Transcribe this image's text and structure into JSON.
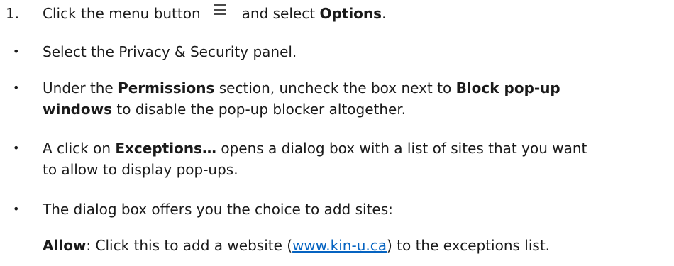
{
  "step1": {
    "number": "1.",
    "text_before": "Click the menu button",
    "menu_icon": "hamburger-menu-icon",
    "text_middle": "and select",
    "bold_term": "Options",
    "text_end": "."
  },
  "bullets": {
    "marker": "•",
    "privacy": {
      "text": "Select the Privacy & Security panel."
    },
    "permissions": {
      "part1": "Under the ",
      "bold1": "Permissions",
      "part2": " section, uncheck the box next to ",
      "bold2": "Block pop-up",
      "bold2_cont": "windows",
      "part3": " to disable the pop-up blocker altogether."
    },
    "exceptions": {
      "part1": "A click on ",
      "bold1": "Exceptions…",
      "part2": " opens a dialog box with a list of sites that you want",
      "line2": "to allow to display pop-ups."
    },
    "dialog": {
      "text": "The dialog box offers you the choice to add sites:"
    }
  },
  "allow_line": {
    "bold": "Allow",
    "part1": ": Click this to add a website (",
    "link_text": "www.kin-u.ca",
    "part2": ") to the exceptions list."
  }
}
